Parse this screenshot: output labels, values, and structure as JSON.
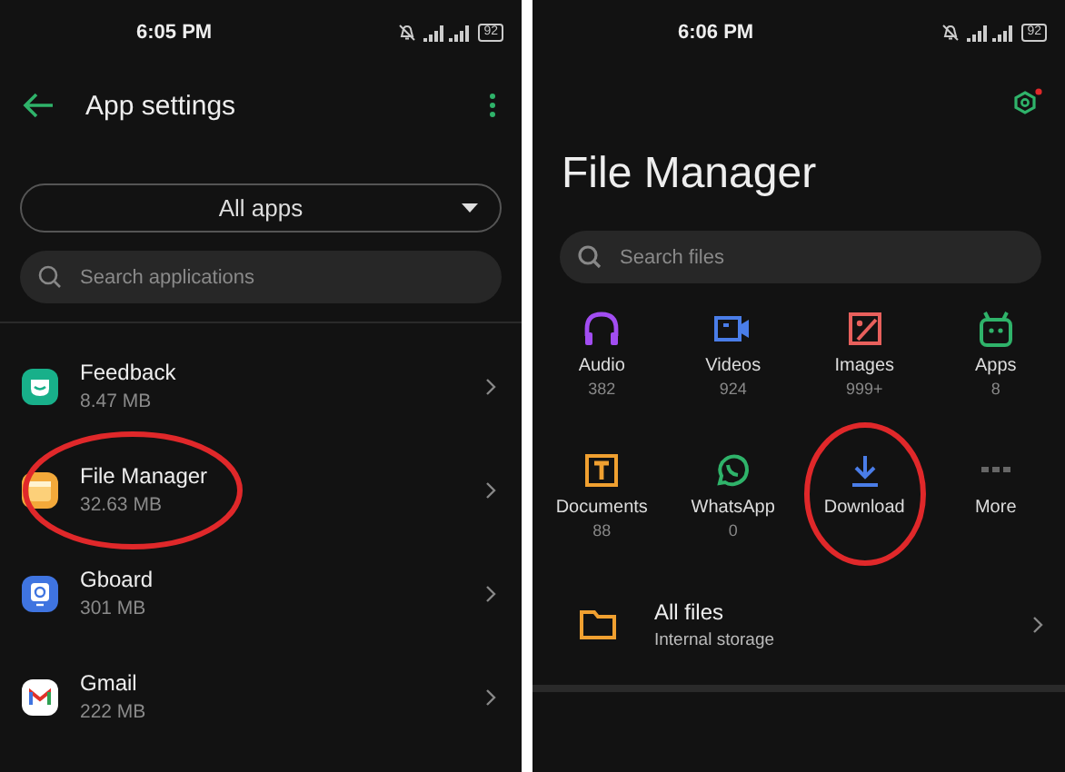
{
  "left": {
    "status_bar": {
      "time": "6:05 PM",
      "battery": "92"
    },
    "title": "App settings",
    "filter": {
      "value": "All apps"
    },
    "search": {
      "placeholder": "Search applications"
    },
    "apps": [
      {
        "name": "Feedback",
        "size": "8.47 MB",
        "kind": "feedback",
        "circled": false
      },
      {
        "name": "File Manager",
        "size": "32.63 MB",
        "kind": "files",
        "circled": true
      },
      {
        "name": "Gboard",
        "size": "301 MB",
        "kind": "keyboard",
        "circled": false
      },
      {
        "name": "Gmail",
        "size": "222 MB",
        "kind": "mail",
        "circled": false
      }
    ]
  },
  "right": {
    "status_bar": {
      "time": "6:06 PM",
      "battery": "92"
    },
    "title": "File Manager",
    "search": {
      "placeholder": "Search files"
    },
    "categories": [
      {
        "label": "Audio",
        "count": "382",
        "kind": "audio",
        "color": "#a24df2",
        "circled": false
      },
      {
        "label": "Videos",
        "count": "924",
        "kind": "video",
        "color": "#4a7de8",
        "circled": false
      },
      {
        "label": "Images",
        "count": "999+",
        "kind": "image",
        "color": "#e8605c",
        "circled": false
      },
      {
        "label": "Apps",
        "count": "8",
        "kind": "android",
        "color": "#2fb36a",
        "circled": false
      },
      {
        "label": "Documents",
        "count": "88",
        "kind": "document",
        "color": "#f0a030",
        "circled": false
      },
      {
        "label": "WhatsApp",
        "count": "0",
        "kind": "chat",
        "color": "#2fb36a",
        "circled": false
      },
      {
        "label": "Download",
        "kind": "download",
        "color": "#4a7de8",
        "circled": true
      },
      {
        "label": "More",
        "kind": "more",
        "color": "#666666",
        "circled": false
      }
    ],
    "all_files": {
      "title": "All files",
      "subtitle": "Internal storage"
    }
  }
}
